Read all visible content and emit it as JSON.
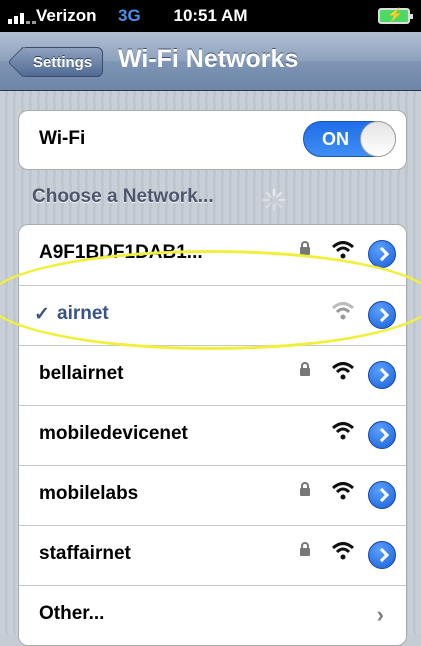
{
  "status_bar": {
    "carrier": "Verizon",
    "network_type": "3G",
    "time": "10:51 AM",
    "network_color": "#4d8ee8"
  },
  "nav": {
    "back_label": "Settings",
    "title": "Wi-Fi Networks"
  },
  "wifi_toggle": {
    "label": "Wi-Fi",
    "state_text": "ON"
  },
  "section_title": "Choose a Network...",
  "networks": [
    {
      "name": "A9F1BDF1DAB1...",
      "locked": true,
      "signal": "full",
      "selected": false
    },
    {
      "name": "airnet",
      "locked": false,
      "signal": "weak",
      "selected": true
    },
    {
      "name": "bellairnet",
      "locked": true,
      "signal": "full",
      "selected": false
    },
    {
      "name": "mobiledevicenet",
      "locked": false,
      "signal": "full",
      "selected": false
    },
    {
      "name": "mobilelabs",
      "locked": true,
      "signal": "full",
      "selected": false
    },
    {
      "name": "staffairnet",
      "locked": true,
      "signal": "full",
      "selected": false
    }
  ],
  "other": {
    "label": "Other...",
    "icon": "chevron-right-icon"
  },
  "colors": {
    "selected_text": "#385487",
    "toggle_on": "#1f6ee8",
    "annotation": "#f2ef3b"
  },
  "icons": {
    "lock": "lock-icon",
    "wifi": "wifi-signal-icon",
    "detail": "detail-disclosure-icon",
    "check": "checkmark-icon"
  }
}
